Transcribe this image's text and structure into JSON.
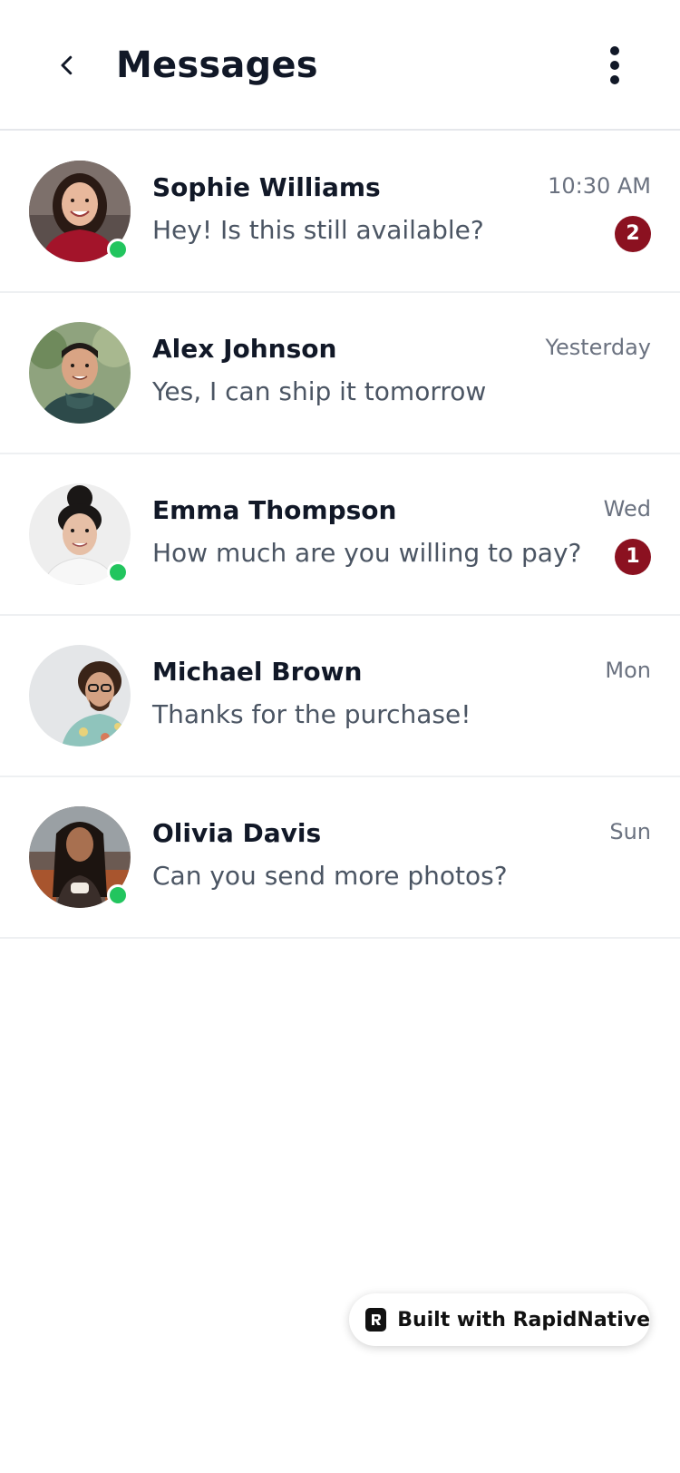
{
  "header": {
    "title": "Messages",
    "back_icon": "chevron-left-icon",
    "menu_icon": "more-vertical-icon"
  },
  "colors": {
    "title_text": "#111827",
    "preview_text": "#4b5563",
    "time_text": "#6b7280",
    "unread_badge": "#8b1120",
    "online_dot": "#22c55e",
    "divider": "#e5e7eb"
  },
  "conversations": [
    {
      "name": "Sophie Williams",
      "preview": "Hey! Is this still available?",
      "time": "10:30 AM",
      "unread": "2",
      "online": true
    },
    {
      "name": "Alex Johnson",
      "preview": "Yes, I can ship it tomorrow",
      "time": "Yesterday",
      "unread": "",
      "online": false
    },
    {
      "name": "Emma Thompson",
      "preview": "How much are you willing to pay?",
      "time": "Wed",
      "unread": "1",
      "online": true
    },
    {
      "name": "Michael Brown",
      "preview": "Thanks for the purchase!",
      "time": "Mon",
      "unread": "",
      "online": false
    },
    {
      "name": "Olivia Davis",
      "preview": "Can you send more photos?",
      "time": "Sun",
      "unread": "",
      "online": true
    }
  ],
  "footer_badge": {
    "label": "Built with RapidNative",
    "icon": "rapidnative-logo-icon"
  }
}
